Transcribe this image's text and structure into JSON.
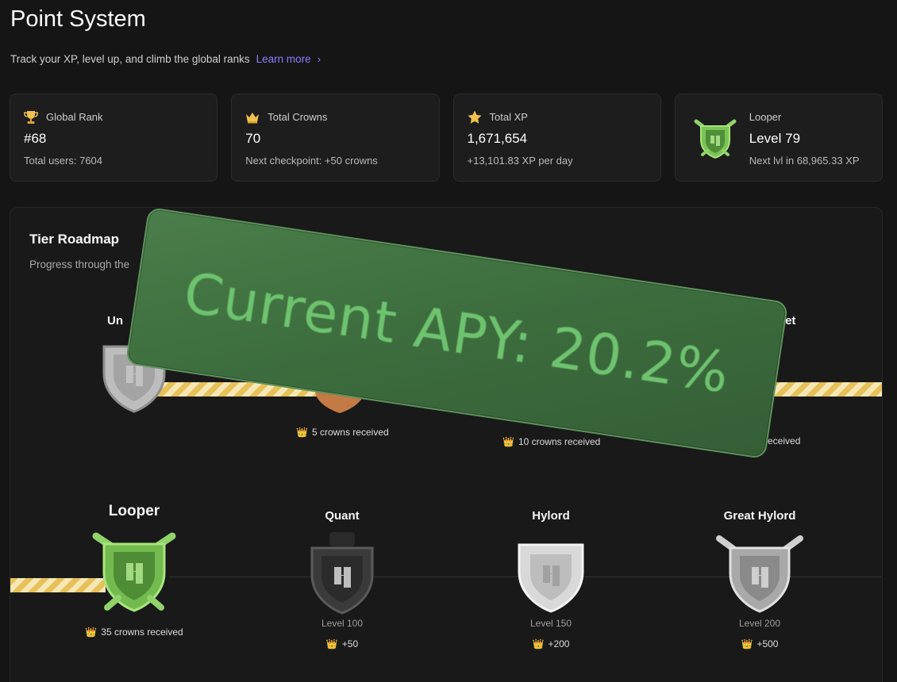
{
  "header": {
    "title": "Point System",
    "subtitle": "Track your XP, level up, and climb the global ranks",
    "learn_more": "Learn more",
    "chevron": "›"
  },
  "stats": [
    {
      "label": "Global Rank",
      "value": "#68",
      "sub": "Total users: 7604",
      "icon": "trophy-icon"
    },
    {
      "label": "Total Crowns",
      "value": "70",
      "sub": "Next checkpoint: +50 crowns",
      "icon": "crown-icon"
    },
    {
      "label": "Total XP",
      "value": "1,671,654",
      "sub": "+13,101.83 XP per day",
      "icon": "star-icon"
    },
    {
      "label": "Looper",
      "value": "Level 79",
      "sub": "Next lvl in 68,965.33 XP",
      "icon": "looper-shield-icon"
    }
  ],
  "roadmap": {
    "title": "Tier Roadmap",
    "subtitle": "Progress through the",
    "row1": [
      {
        "name": "Un",
        "crowns": ""
      },
      {
        "name": "",
        "crowns": "5 crowns received"
      },
      {
        "name": "",
        "crowns": "10 crowns received"
      },
      {
        "name": "Great Manlet",
        "crowns": "eceived"
      }
    ],
    "row2": [
      {
        "name": "Looper",
        "crowns": "35 crowns received",
        "level": "",
        "reward": ""
      },
      {
        "name": "Quant",
        "crowns": "",
        "level": "Level 100",
        "reward": "+50"
      },
      {
        "name": "Hylord",
        "crowns": "",
        "level": "Level 150",
        "reward": "+200"
      },
      {
        "name": "Great Hylord",
        "crowns": "",
        "level": "Level 200",
        "reward": "+500"
      }
    ]
  },
  "overlay": {
    "text": "Current APY: 20.2%"
  },
  "colors": {
    "accent": "#8a7dff",
    "track": "#e6c159",
    "overlay": "#3f6f40"
  }
}
